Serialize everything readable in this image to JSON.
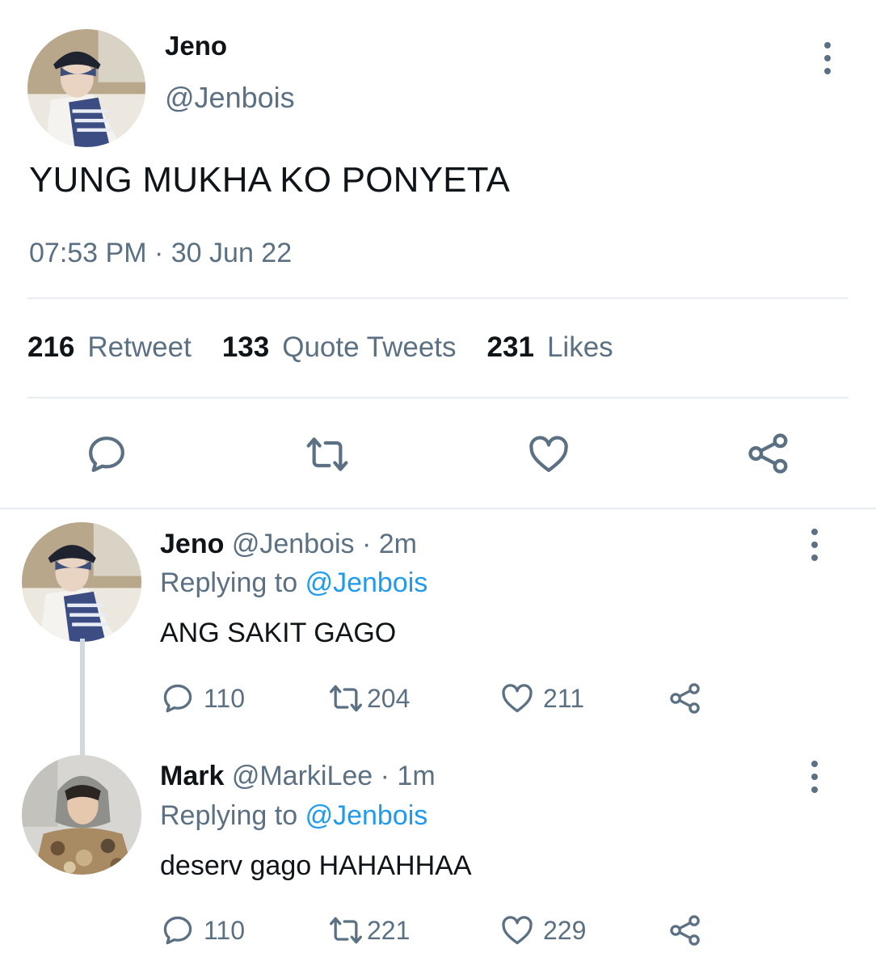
{
  "main_tweet": {
    "name": "Jeno",
    "handle": "@Jenbois",
    "text": "YUNG MUKHA KO PONYETA",
    "time": "07:53 PM",
    "separator": "·",
    "date": "30 Jun 22",
    "stats": [
      {
        "count": "216",
        "label": "Retweet"
      },
      {
        "count": "133",
        "label": "Quote Tweets"
      },
      {
        "count": "231",
        "label": "Likes"
      }
    ],
    "actions": [
      "reply-icon",
      "retweet-icon",
      "like-icon",
      "share-icon"
    ]
  },
  "replies": [
    {
      "name": "Jeno",
      "handle": "@Jenbois",
      "dot": "·",
      "time": "2m",
      "replying_label": "Replying to",
      "replying_to": "@Jenbois",
      "text": "ANG SAKIT GAGO",
      "reply_count": "110",
      "retweet_count": "204",
      "like_count": "211"
    },
    {
      "name": "Mark",
      "handle": "@MarkiLee",
      "dot": "·",
      "time": "1m",
      "replying_label": "Replying to",
      "replying_to": "@Jenbois",
      "text": "deserv gago HAHAHHAA",
      "reply_count": "110",
      "retweet_count": "221",
      "like_count": "229"
    }
  ],
  "colors": {
    "text": "#0f1419",
    "secondary": "#5b7083",
    "link": "#1d9bf0",
    "divider": "#e6ecf0"
  }
}
